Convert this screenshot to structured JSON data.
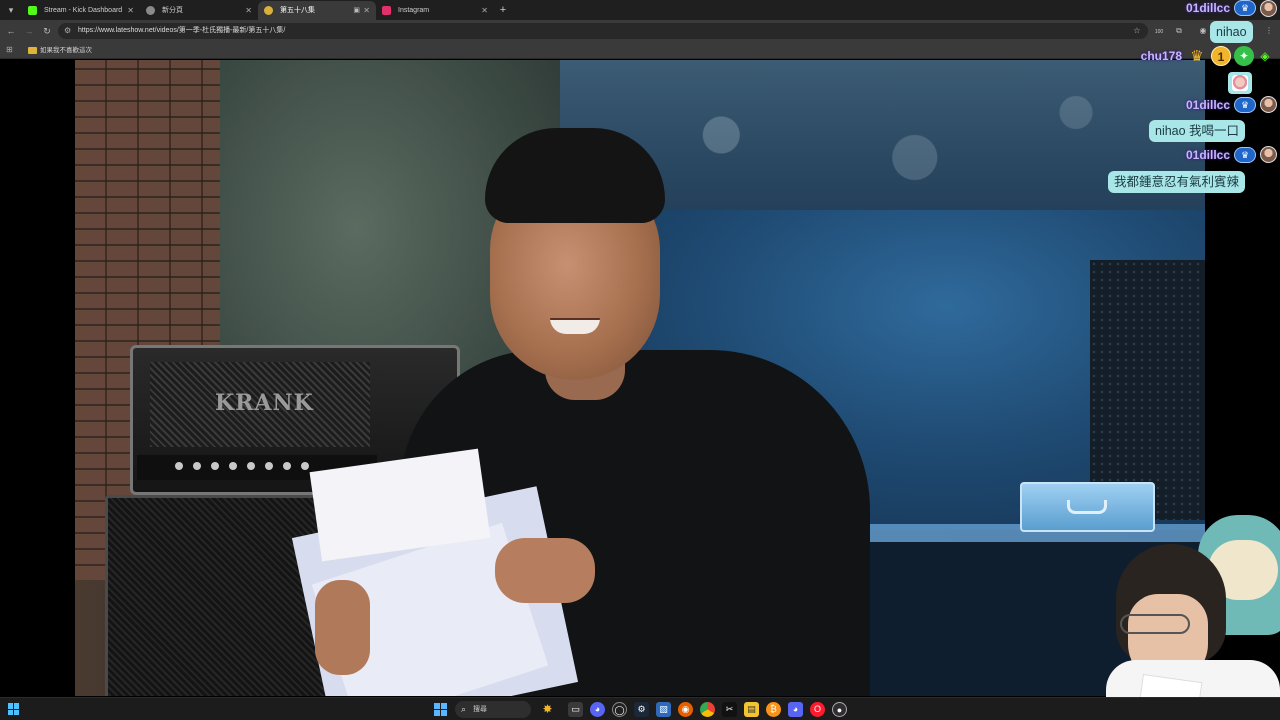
{
  "browser": {
    "tabs": [
      {
        "title": "Stream - Kick Dashboard",
        "favicon_color": "#53fc18",
        "active": false
      },
      {
        "title": "新分頁",
        "favicon_color": "#8a8a8a",
        "active": false
      },
      {
        "title": "第五十八集",
        "favicon_color": "#d9b03a",
        "active": true
      },
      {
        "title": "Instagram",
        "favicon_color": "#e1306c",
        "active": false
      }
    ],
    "url": "https://www.lateshow.net/videos/第一季-杜氏獨播-最新/第五十八集/",
    "bookmark_folder": "如果我不喜歡這次",
    "extension_badge": "100"
  },
  "video": {
    "amp_brand": "KRANK"
  },
  "chat": {
    "messages": [
      {
        "user": "01dillcc",
        "text": "nihao"
      },
      {
        "user": "chu178",
        "text": ""
      },
      {
        "user": "01dillcc",
        "text": "nihao 我喝一口"
      },
      {
        "user": "01dillcc",
        "text": "我都鍾意忍有氣利賓辣"
      }
    ],
    "mod_badge": "♛",
    "badge_one": "1",
    "colors": {
      "bubble": "#a8e6e8",
      "username": "#c9b4ff",
      "mod": "#1f66c8"
    }
  },
  "taskbar": {
    "search_placeholder": "搜尋",
    "icons": [
      "start-icon",
      "search-icon",
      "game-icon",
      "file-manager-icon",
      "discord-icon",
      "app-icon",
      "steam-icon",
      "edge-icon",
      "photos-icon",
      "firefox-icon",
      "chrome-icon",
      "capcut-icon",
      "explorer-icon",
      "bitcoin-icon",
      "discord2-icon",
      "opera-icon",
      "obs-icon"
    ]
  }
}
